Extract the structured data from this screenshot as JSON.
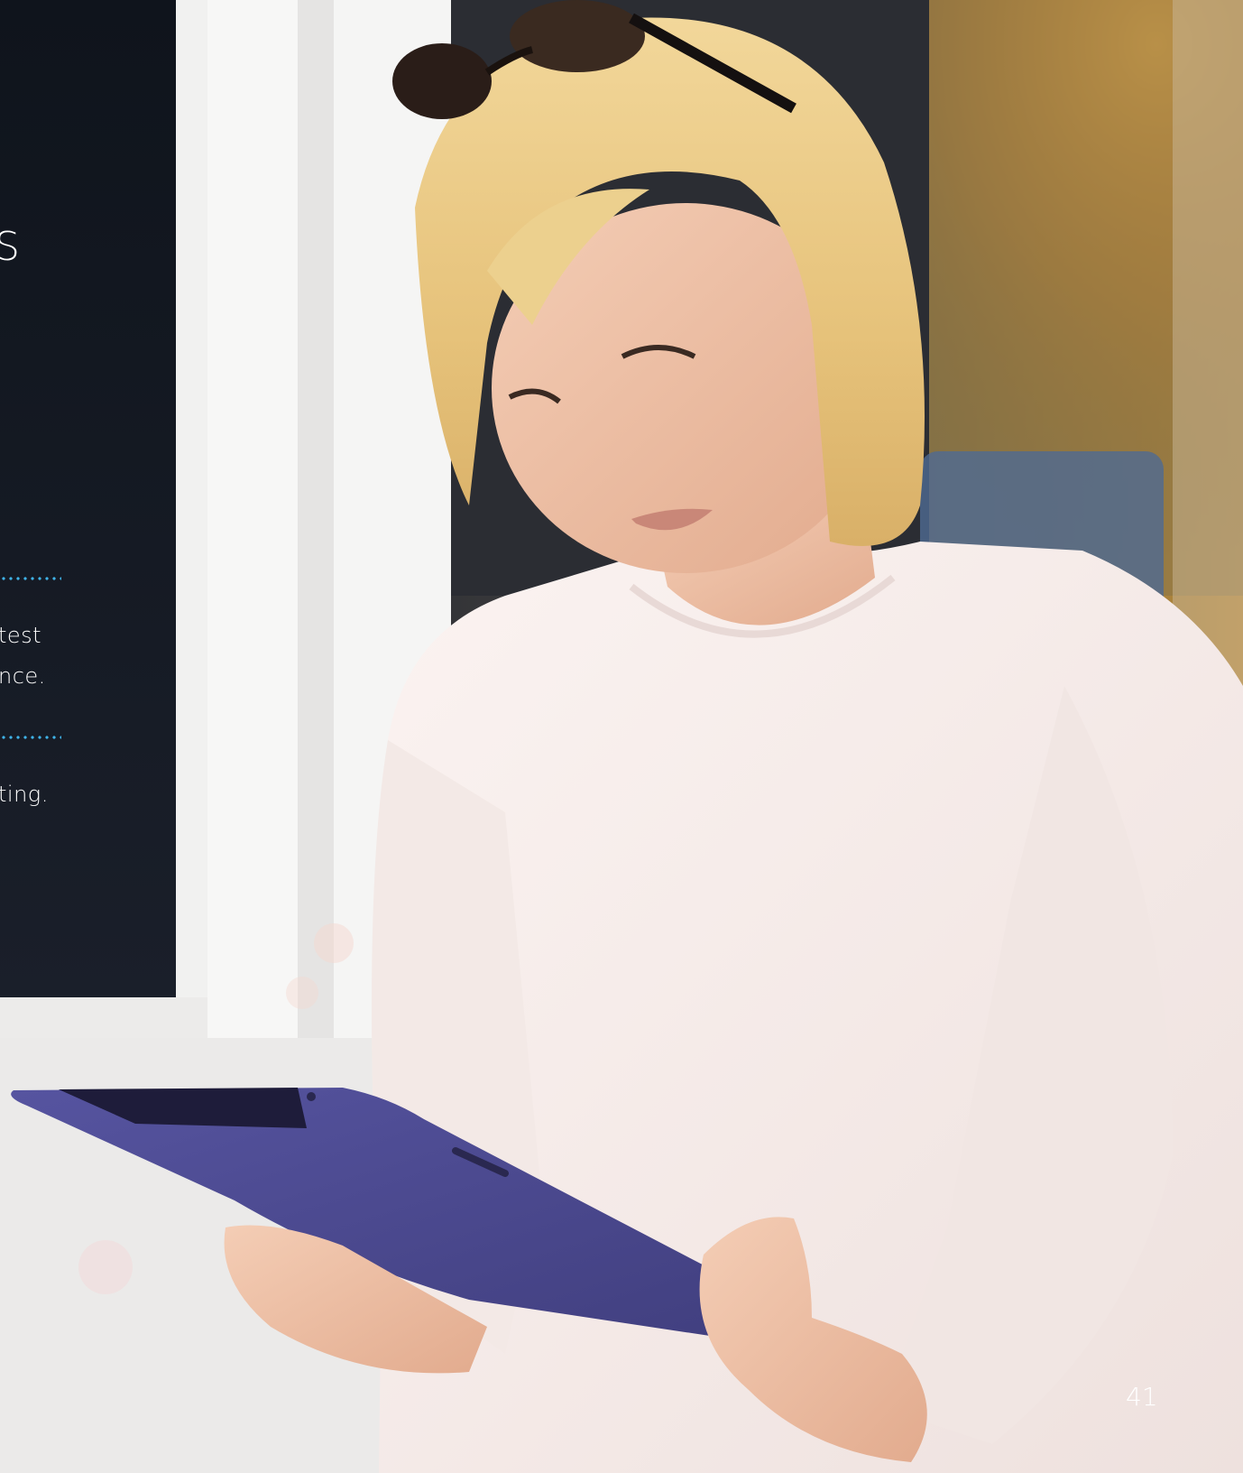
{
  "overlay": {
    "heading_fragment": "S",
    "lines": [
      "test",
      "nce.",
      "ting."
    ]
  },
  "page_number": "41",
  "colors": {
    "accent_dots": "#3fb3e8",
    "tablet": "#4a4888",
    "sweater": "#f5eeec"
  }
}
